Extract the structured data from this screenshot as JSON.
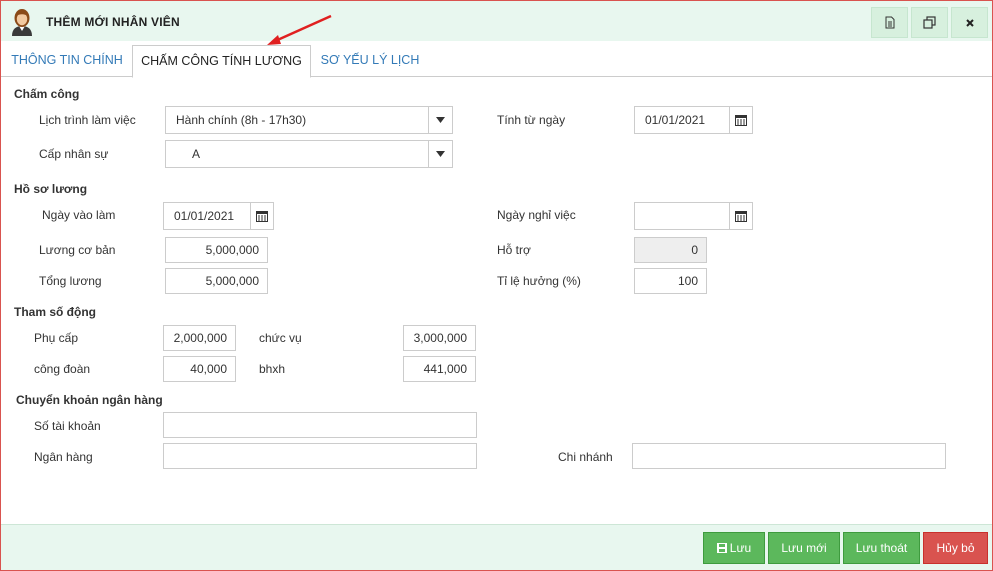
{
  "window": {
    "title": "THÊM MỚI NHÂN VIÊN"
  },
  "tabs": [
    {
      "label": "THÔNG TIN CHÍNH"
    },
    {
      "label": "CHẤM CÔNG TÍNH LƯƠNG"
    },
    {
      "label": "SƠ YẾU LÝ LỊCH"
    }
  ],
  "cham_cong": {
    "title": "Chấm công",
    "lich_trinh_label": "Lịch trình làm việc",
    "lich_trinh_value": "Hành chính (8h - 17h30)",
    "cap_nhan_su_label": "Cấp nhân sự",
    "cap_nhan_su_value": "A",
    "tinh_tu_ngay_label": "Tính từ ngày",
    "tinh_tu_ngay_value": "01/01/2021"
  },
  "ho_so_luong": {
    "title": "Hồ sơ lương",
    "ngay_vao_lam_label": "Ngày vào làm",
    "ngay_vao_lam_value": "01/01/2021",
    "ngay_nghi_viec_label": "Ngày nghỉ việc",
    "ngay_nghi_viec_value": "",
    "luong_co_ban_label": "Lương cơ bản",
    "luong_co_ban_value": "5,000,000",
    "ho_tro_label": "Hỗ trợ",
    "ho_tro_value": "0",
    "tong_luong_label": "Tổng lương",
    "tong_luong_value": "5,000,000",
    "ti_le_huong_label": "Tỉ lệ hưởng (%)",
    "ti_le_huong_value": "100"
  },
  "tham_so_dong": {
    "title": "Tham số động",
    "phu_cap_label": "Phụ cấp",
    "phu_cap_value": "2,000,000",
    "chuc_vu_label": "chức vụ",
    "chuc_vu_value": "3,000,000",
    "cong_doan_label": "công đoàn",
    "cong_doan_value": "40,000",
    "bhxh_label": "bhxh",
    "bhxh_value": "441,000"
  },
  "chuyen_khoan": {
    "title": "Chuyển khoản ngân hàng",
    "so_tai_khoan_label": "Số tài khoản",
    "so_tai_khoan_value": "",
    "ngan_hang_label": "Ngân hàng",
    "ngan_hang_value": "",
    "chi_nhanh_label": "Chi nhánh",
    "chi_nhanh_value": ""
  },
  "footer": {
    "luu": "Lưu",
    "luu_moi": "Lưu mới",
    "luu_thoat": "Lưu thoát",
    "huy_bo": "Hủy bỏ"
  },
  "colors": {
    "header_bg": "#e8f7ef",
    "button_green": "#5cb85c",
    "button_red": "#d9534f",
    "tab_link": "#337ab7",
    "annotation_arrow": "#e02020"
  }
}
